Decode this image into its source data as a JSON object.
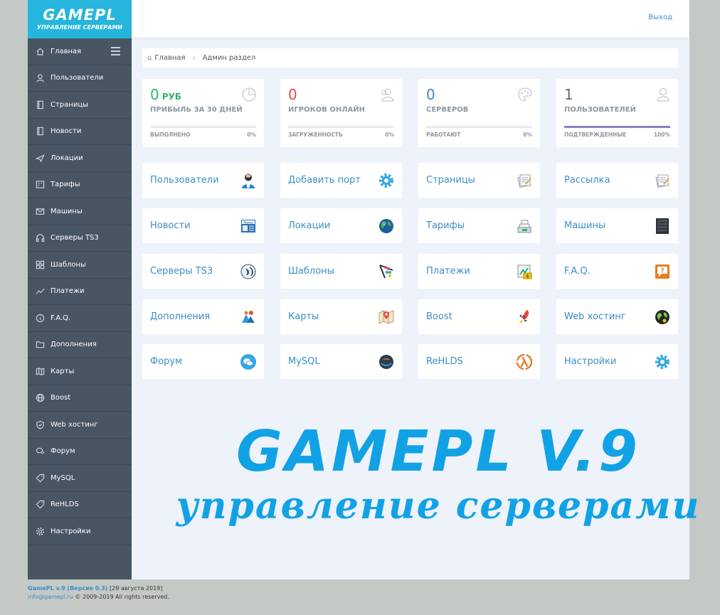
{
  "logo": {
    "line1": "GAMEPL",
    "line2": "УПРАВЛЕНИЕ СЕРВЕРАМИ"
  },
  "topbar": {
    "logout": "Выход"
  },
  "sidebar": {
    "items": [
      {
        "label": "Главная",
        "icon": "home-icon"
      },
      {
        "label": "Пользователи",
        "icon": "user-icon"
      },
      {
        "label": "Страницы",
        "icon": "pages-icon"
      },
      {
        "label": "Новости",
        "icon": "news-icon"
      },
      {
        "label": "Локации",
        "icon": "plane-icon"
      },
      {
        "label": "Тарифы",
        "icon": "tariff-icon"
      },
      {
        "label": "Машины",
        "icon": "machine-icon"
      },
      {
        "label": "Серверы TS3",
        "icon": "headphones-icon"
      },
      {
        "label": "Шаблоны",
        "icon": "grid-icon"
      },
      {
        "label": "Платежи",
        "icon": "chart-icon"
      },
      {
        "label": "F.A.Q.",
        "icon": "info-icon"
      },
      {
        "label": "Дополнения",
        "icon": "folder-icon"
      },
      {
        "label": "Карты",
        "icon": "map-icon"
      },
      {
        "label": "Boost",
        "icon": "globe-icon"
      },
      {
        "label": "Web хостинг",
        "icon": "shield-icon"
      },
      {
        "label": "Форум",
        "icon": "chat-icon"
      },
      {
        "label": "MySQL",
        "icon": "tag-icon"
      },
      {
        "label": "ReHLDS",
        "icon": "tag-icon"
      },
      {
        "label": "Настройки",
        "icon": "gear-icon"
      }
    ]
  },
  "breadcrumb": {
    "home": "Главная",
    "current": "Админ раздел"
  },
  "stats": [
    {
      "value": "0",
      "unit": "РУБ",
      "label": "ПРИБЫЛЬ ЗА 30 ДНЕЙ",
      "sub": "ВЫПОЛНЕНО",
      "pct": "0%",
      "progress": 0,
      "color": "#2bb673",
      "bar_color": "#2bb673",
      "icon": "pie-icon"
    },
    {
      "value": "0",
      "unit": "",
      "label": "ИГРОКОВ ОНЛАЙН",
      "sub": "ЗАГРУЖЕННОСТЬ",
      "pct": "0%",
      "progress": 0,
      "color": "#e74c3c",
      "bar_color": "#e74c3c",
      "icon": "users-icon"
    },
    {
      "value": "0",
      "unit": "",
      "label": "СЕРВЕРОВ",
      "sub": "РАБОТАЮТ",
      "pct": "0%",
      "progress": 0,
      "color": "#3c8dc5",
      "bar_color": "#3c8dc5",
      "icon": "palette-icon"
    },
    {
      "value": "1",
      "unit": "",
      "label": "ПОЛЬЗОВАТЕЛЕЙ",
      "sub": "ПОДТВЕРЖДЕННЫЕ",
      "pct": "100%",
      "progress": 100,
      "color": "#5b6b7d",
      "bar_color": "#8e7cc3",
      "icon": "user-outline-icon"
    }
  ],
  "tiles": [
    {
      "label": "Пользователи",
      "icon": "user-avatar-icon"
    },
    {
      "label": "Добавить порт",
      "icon": "gear-icon"
    },
    {
      "label": "Страницы",
      "icon": "pages-icon"
    },
    {
      "label": "Рассылка",
      "icon": "mail-icon"
    },
    {
      "label": "Новости",
      "icon": "news-icon"
    },
    {
      "label": "Локации",
      "icon": "globe-icon"
    },
    {
      "label": "Тарифы",
      "icon": "cash-register-icon"
    },
    {
      "label": "Машины",
      "icon": "server-rack-icon"
    },
    {
      "label": "Серверы TS3",
      "icon": "teamspeak-icon"
    },
    {
      "label": "Шаблоны",
      "icon": "template-icon"
    },
    {
      "label": "Платежи",
      "icon": "payment-icon"
    },
    {
      "label": "F.A.Q.",
      "icon": "help-icon"
    },
    {
      "label": "Дополнения",
      "icon": "addons-icon"
    },
    {
      "label": "Карты",
      "icon": "map-icon"
    },
    {
      "label": "Boost",
      "icon": "rocket-icon"
    },
    {
      "label": "Web хостинг",
      "icon": "web-globe-icon"
    },
    {
      "label": "Форум",
      "icon": "chat-icon"
    },
    {
      "label": "MySQL",
      "icon": "mysql-icon"
    },
    {
      "label": "ReHLDS",
      "icon": "lambda-icon"
    },
    {
      "label": "Настройки",
      "icon": "gear-icon"
    }
  ],
  "banner": {
    "line1": "GAMEPL V.9",
    "line2": "управление серверами"
  },
  "footer": {
    "product": "GamePL v.9 (Версия 0.3)",
    "date": "[29 августа 2019]",
    "email": "info@gamepl.ru",
    "copyright": "© 2009-2019 All rights reserved."
  }
}
